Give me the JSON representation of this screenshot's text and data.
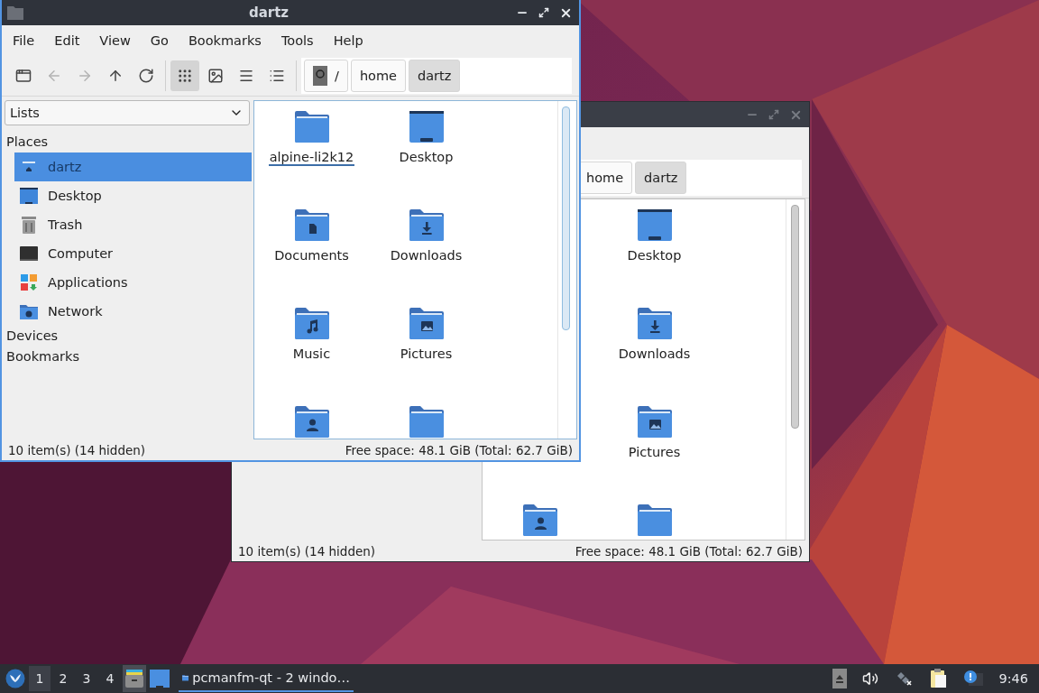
{
  "front_window": {
    "title": "dartz",
    "menu": [
      "File",
      "Edit",
      "View",
      "Go",
      "Bookmarks",
      "Tools",
      "Help"
    ],
    "nav_buttons": [
      {
        "kind": "new-window",
        "disabled": false
      },
      {
        "kind": "back",
        "disabled": true
      },
      {
        "kind": "forward",
        "disabled": true
      },
      {
        "kind": "up",
        "disabled": false
      },
      {
        "kind": "reload",
        "disabled": false
      }
    ],
    "view_buttons": [
      {
        "kind": "icons",
        "selected": true
      },
      {
        "kind": "thumbnails",
        "selected": false
      },
      {
        "kind": "compact",
        "selected": false
      },
      {
        "kind": "details",
        "selected": false
      }
    ],
    "path_bar": [
      {
        "label": "/",
        "kind": "root",
        "selected": false
      },
      {
        "label": "home",
        "kind": "dir",
        "selected": false
      },
      {
        "label": "dartz",
        "kind": "dir",
        "selected": true
      }
    ],
    "side_pane": {
      "combo": "Lists",
      "sections": [
        {
          "title": "Places",
          "items": [
            {
              "label": "dartz",
              "kind": "home",
              "selected": true
            },
            {
              "label": "Desktop",
              "kind": "desktop",
              "selected": false
            },
            {
              "label": "Trash",
              "kind": "trash",
              "selected": false
            },
            {
              "label": "Computer",
              "kind": "computer",
              "selected": false
            },
            {
              "label": "Applications",
              "kind": "apps",
              "selected": false
            },
            {
              "label": "Network",
              "kind": "network",
              "selected": false
            }
          ]
        },
        {
          "title": "Devices"
        },
        {
          "title": "Bookmarks"
        }
      ]
    },
    "icon_view": [
      {
        "label": "alpine-li2k12",
        "kind": "folder",
        "focused": true
      },
      {
        "label": "Desktop",
        "kind": "desktop",
        "focused": false
      },
      {
        "label": "Documents",
        "kind": "documents",
        "focused": false
      },
      {
        "label": "Downloads",
        "kind": "downloads",
        "focused": false
      },
      {
        "label": "Music",
        "kind": "music",
        "focused": false
      },
      {
        "label": "Pictures",
        "kind": "pictures",
        "focused": false
      },
      {
        "kind": "user"
      },
      {
        "kind": "folder"
      }
    ],
    "status": {
      "items": "10 item(s) (14 hidden)",
      "space": "Free space: 48.1 GiB (Total: 62.7 GiB)"
    }
  },
  "back_window": {
    "path_bar": [
      {
        "label": "home",
        "selected": false
      },
      {
        "label": "dartz",
        "selected": true
      }
    ],
    "icon_view": [
      {
        "label": "Desktop",
        "kind": "desktop"
      },
      {
        "label": "Downloads",
        "kind": "downloads"
      },
      {
        "label": "Pictures",
        "kind": "pictures"
      },
      {
        "kind": "user"
      },
      {
        "kind": "folder"
      }
    ],
    "status": {
      "items": "10 item(s) (14 hidden)",
      "space": "Free space: 48.1 GiB (Total: 62.7 GiB)"
    }
  },
  "taskbar": {
    "workspaces": [
      {
        "label": "1",
        "selected": true
      },
      {
        "label": "2",
        "selected": false
      },
      {
        "label": "3",
        "selected": false
      },
      {
        "label": "4",
        "selected": false
      }
    ],
    "task": {
      "label": "pcmanfm-qt - 2 windo…",
      "selected": true
    },
    "clock": "9:46"
  }
}
